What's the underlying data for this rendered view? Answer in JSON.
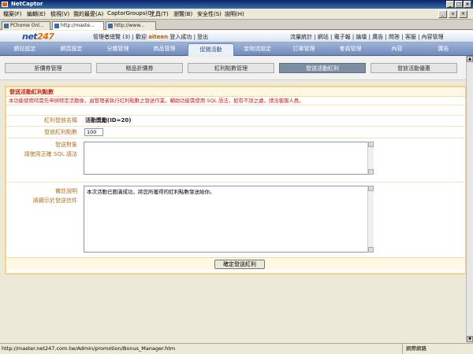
{
  "window": {
    "title": "NetCaptor"
  },
  "menubar": {
    "items": [
      "檔案(F)",
      "編輯(E)",
      "檢視(V)",
      "我的最愛(A)",
      "CaptorGroups(G)",
      "工具(T)",
      "瀏覽(B)",
      "安全性(S)",
      "說明(H)"
    ]
  },
  "doc_tabs": [
    "PChome Onl...",
    "http://maste...",
    "http://www..."
  ],
  "site": {
    "logo_main": "net",
    "logo_num": "247",
    "top_links": "管理者總覽 (3) | 歡迎 ",
    "user": "aiteen",
    "top_links_after": " 登入成功 | 登出",
    "right_links": "流量統計 | 網站 | 電子報 | 論壇 | 廣告 | 問答 | 客服 | 內容管理"
  },
  "main_nav": [
    "網站設定",
    "網頁設定",
    "分類管理",
    "商品管理",
    "促銷活動",
    "金物流設定",
    "訂單管理",
    "會員管理",
    "內容",
    "廣告"
  ],
  "sub_nav": [
    "折價券管理",
    "贈品折價券",
    "紅利點數管理",
    "發送活動紅利",
    "發放活動優惠"
  ],
  "panel": {
    "title": "發送活動紅利點數",
    "note": "本功能使用時需先申辦特定活動後，由管理者執行紅利點數之發送作業，輔助功能需使用 SQL 語法，如有不詳之處，請洽客服人員。",
    "rows": {
      "activity_label": "紅利發放名稱",
      "activity_value": "活動獎勵(ID=20)",
      "points_label": "發放紅利點數",
      "points_value": "100",
      "condition_label_1": "發送對象",
      "condition_label_2": "請使用正確 SQL 語法",
      "condition_value": "",
      "message_label_1": "備註說明",
      "message_label_2": "將顯示於發送信件",
      "message_value": "本次活動已圓滿成功，將您所獲得的紅利點數發送給你。"
    },
    "submit_label": "確定發送紅利"
  },
  "statusbar": {
    "url": "http://master.net247.com.tw/Admin/promotion/Bonus_Manager.htm",
    "zone": "網際網路"
  }
}
